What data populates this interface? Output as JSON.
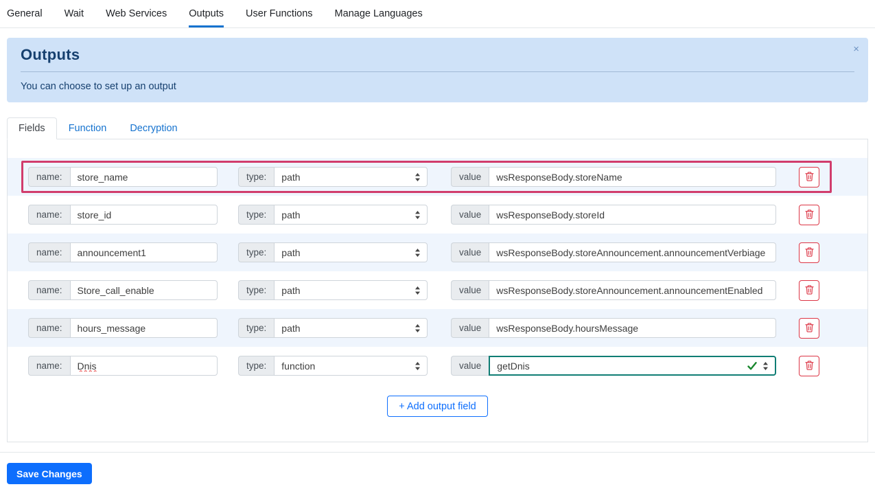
{
  "top_nav": {
    "items": [
      {
        "label": "General",
        "active": false
      },
      {
        "label": "Wait",
        "active": false
      },
      {
        "label": "Web Services",
        "active": false
      },
      {
        "label": "Outputs",
        "active": true
      },
      {
        "label": "User Functions",
        "active": false
      },
      {
        "label": "Manage Languages",
        "active": false
      }
    ]
  },
  "alert": {
    "title": "Outputs",
    "message": "You can choose to set up an output",
    "close_label": "×"
  },
  "tabs": [
    {
      "label": "Fields",
      "active": true
    },
    {
      "label": "Function",
      "active": false
    },
    {
      "label": "Decryption",
      "active": false
    }
  ],
  "fields": {
    "name_label": "name:",
    "type_label": "type:",
    "value_label": "value",
    "rows": [
      {
        "name": "store_name",
        "type": "path",
        "value": "wsResponseBody.storeName",
        "highlighted": true
      },
      {
        "name": "store_id",
        "type": "path",
        "value": "wsResponseBody.storeId",
        "highlighted": false
      },
      {
        "name": "announcement1",
        "type": "path",
        "value": "wsResponseBody.storeAnnouncement.announcementVerbiage",
        "highlighted": false
      },
      {
        "name": "Store_call_enable",
        "type": "path",
        "value": "wsResponseBody.storeAnnouncement.announcementEnabled",
        "highlighted": false
      },
      {
        "name": "hours_message",
        "type": "path",
        "value": "wsResponseBody.hoursMessage",
        "highlighted": false
      },
      {
        "name": "Dnis",
        "type": "function",
        "value": "getDnis",
        "highlighted": false,
        "valid": true
      }
    ],
    "add_button_label": "+ Add output field"
  },
  "footer": {
    "save_label": "Save Changes"
  },
  "colors": {
    "accent_blue": "#1673cf",
    "button_blue": "#0d6efd",
    "alert_bg": "#cfe2f8",
    "alert_text": "#16406f",
    "highlight_pink": "#d13c6c",
    "danger_red": "#dc3545",
    "valid_teal": "#0f7d74",
    "check_green": "#19872e",
    "stripe_blue": "#eff5fd"
  }
}
